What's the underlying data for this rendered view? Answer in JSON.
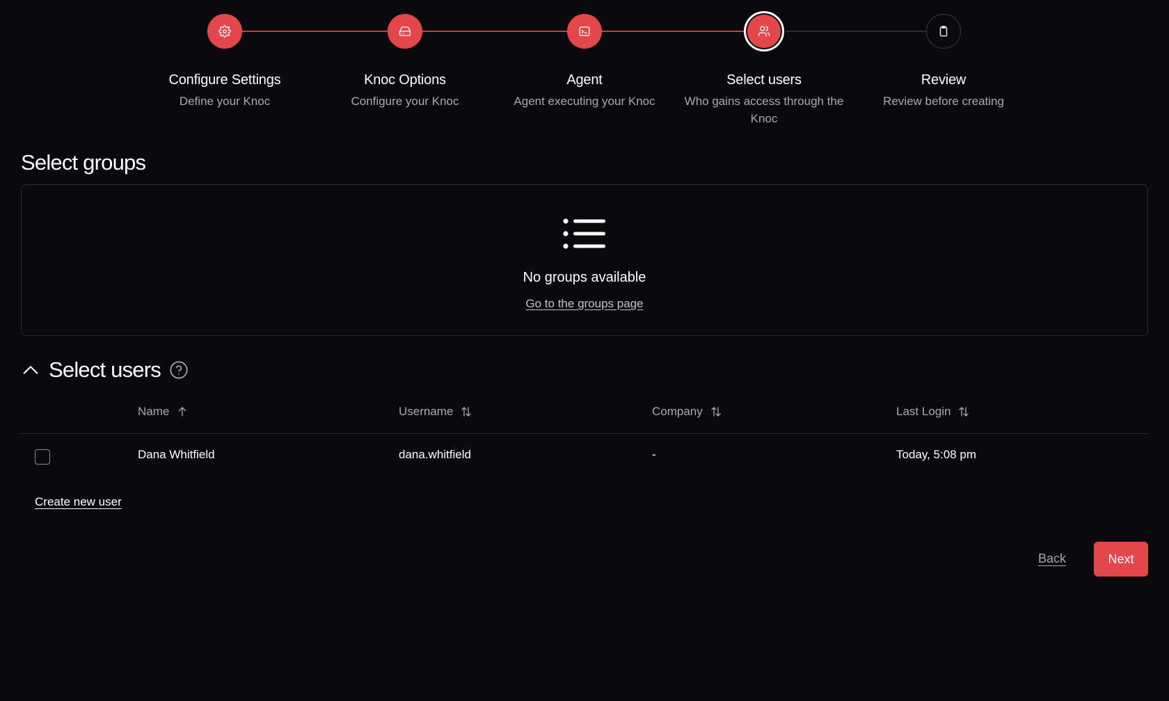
{
  "stepper": {
    "steps": [
      {
        "title": "Configure Settings",
        "subtitle": "Define your Knoc",
        "icon": "gear-icon",
        "state": "done"
      },
      {
        "title": "Knoc Options",
        "subtitle": "Configure your Knoc",
        "icon": "drive-icon",
        "state": "done"
      },
      {
        "title": "Agent",
        "subtitle": "Agent executing your Knoc",
        "icon": "terminal-icon",
        "state": "done"
      },
      {
        "title": "Select users",
        "subtitle": "Who gains access through the Knoc",
        "icon": "users-icon",
        "state": "current"
      },
      {
        "title": "Review",
        "subtitle": "Review before creating",
        "icon": "clipboard-icon",
        "state": "pending"
      }
    ]
  },
  "groups": {
    "title": "Select groups",
    "empty_title": "No groups available",
    "empty_link": "Go to the groups page"
  },
  "users": {
    "title": "Select users",
    "columns": {
      "name": "Name",
      "username": "Username",
      "company": "Company",
      "last_login": "Last Login"
    },
    "rows": [
      {
        "name": "Dana Whitfield",
        "username": "dana.whitfield",
        "company": "-",
        "last_login": "Today, 5:08 pm"
      }
    ],
    "create_link": "Create new user"
  },
  "footer": {
    "back_label": "Back",
    "next_label": "Next"
  },
  "colors": {
    "accent": "#e4474b",
    "background": "#0a0a0d",
    "muted_text": "#a8a8ae"
  }
}
